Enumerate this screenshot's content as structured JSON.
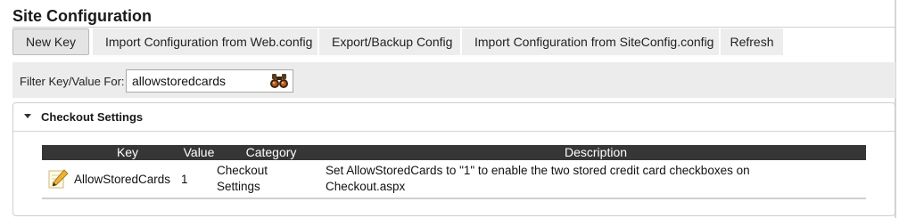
{
  "page": {
    "title": "Site Configuration"
  },
  "toolbar": {
    "new_key": "New Key",
    "import_webconfig": "Import Configuration from Web.config",
    "export_backup": "Export/Backup Config",
    "import_siteconfig": "Import Configuration from SiteConfig.config",
    "refresh": "Refresh"
  },
  "filter": {
    "label": "Filter Key/Value For:",
    "value": "allowstoredcards",
    "search_icon": "binoculars-icon"
  },
  "panel": {
    "title": "Checkout Settings",
    "toggle_icon": "caret-down-icon"
  },
  "table": {
    "headers": {
      "key": "Key",
      "value": "Value",
      "category": "Category",
      "description": "Description"
    },
    "rows": [
      {
        "edit_icon": "pencil-edit-icon",
        "key": "AllowStoredCards",
        "value": "1",
        "category_line1": "Checkout",
        "category_line2": "Settings",
        "description_line1": "Set AllowStoredCards to \"1\" to enable the two stored credit card checkboxes on",
        "description_line2": "Checkout.aspx"
      }
    ]
  },
  "colors": {
    "header_bg": "#363636",
    "toolbar_bg": "#ededed",
    "filter_bg": "#ececec"
  }
}
